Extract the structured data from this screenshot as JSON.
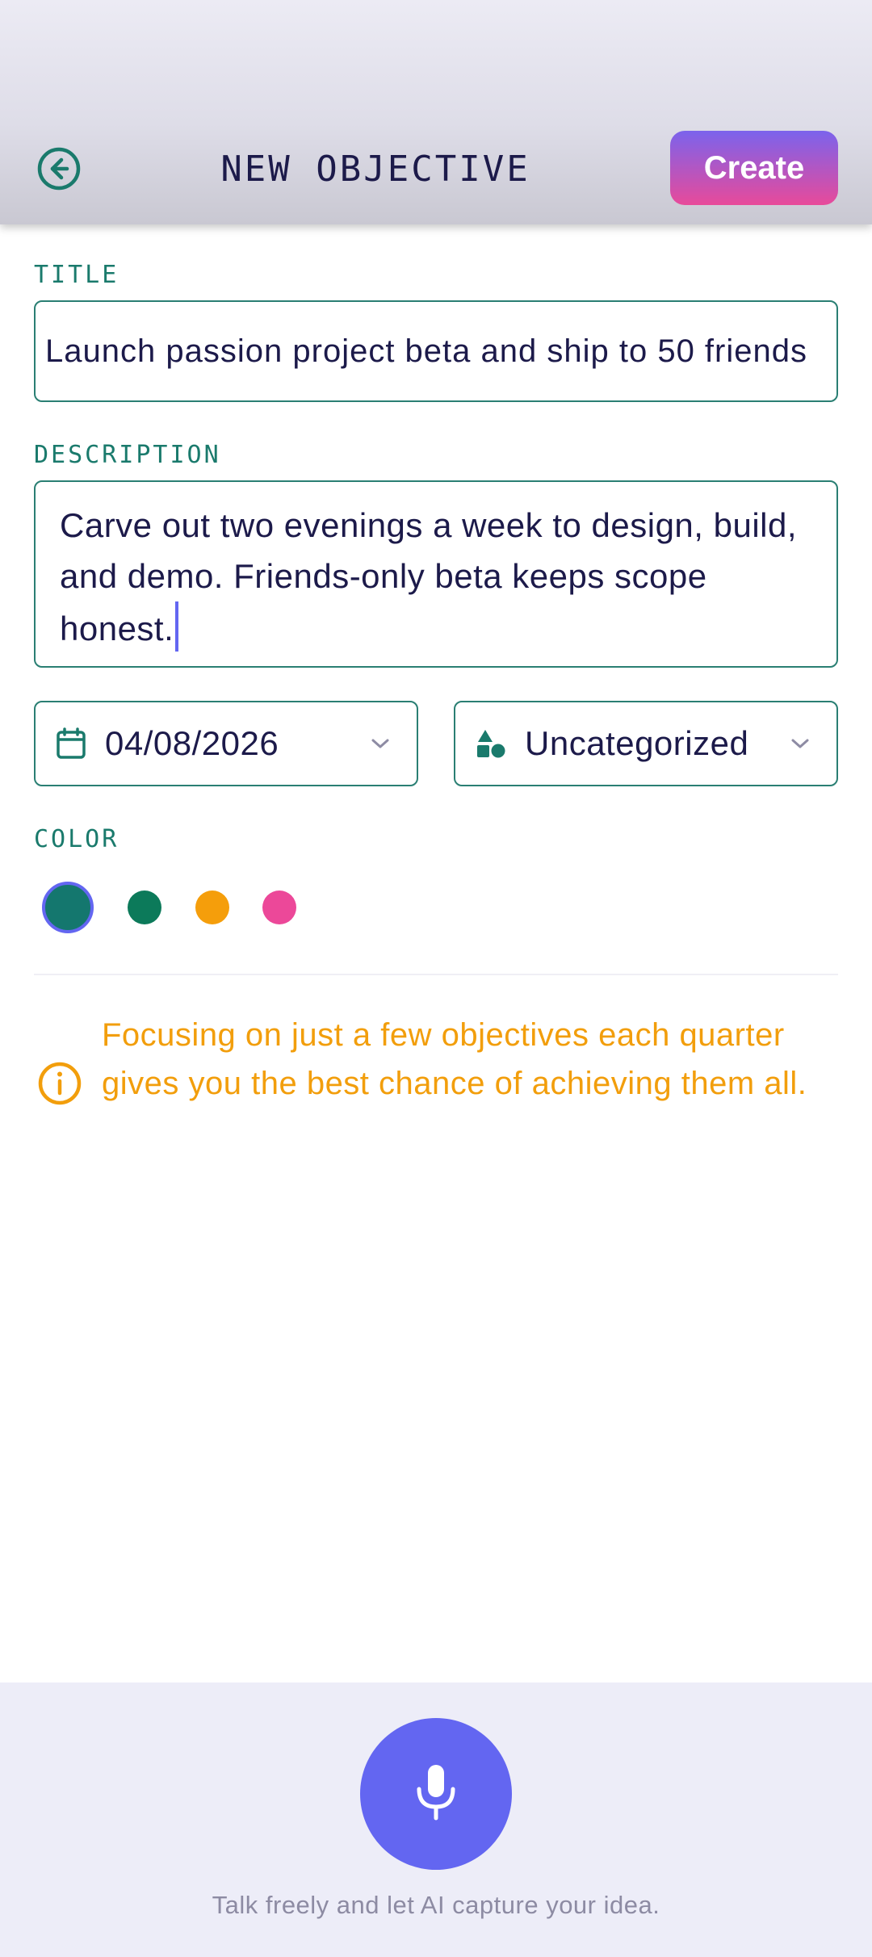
{
  "header": {
    "title": "NEW OBJECTIVE",
    "create_label": "Create"
  },
  "form": {
    "title_label": "TITLE",
    "title_value": "Launch passion project beta and ship to 50 friends",
    "description_label": "DESCRIPTION",
    "description_value": "Carve out two evenings a week to design, build, and demo. Friends-only beta keeps scope honest.",
    "date_value": "04/08/2026",
    "category_value": "Uncategorized",
    "color_label": "COLOR",
    "colors": [
      {
        "name": "teal",
        "hex": "#14776e",
        "selected": true
      },
      {
        "name": "green",
        "hex": "#0c7a5a",
        "selected": false
      },
      {
        "name": "amber",
        "hex": "#f59e0b",
        "selected": false
      },
      {
        "name": "pink",
        "hex": "#ec4899",
        "selected": false
      }
    ]
  },
  "tip": {
    "text": "Focusing on just a few objectives each quarter gives you the best chance of achieving them all."
  },
  "voice": {
    "hint": "Talk freely and let AI capture your idea."
  },
  "theme": {
    "accent": "#6366f1",
    "teal": "#1a7a6c",
    "warning": "#f29e0c",
    "create_gradient": [
      "#7b63ec",
      "#e84a9a"
    ]
  },
  "icons": {
    "back": "arrow-left-circle-icon",
    "calendar": "calendar-icon",
    "category": "shapes-icon",
    "chevron": "chevron-down-icon",
    "info": "info-circle-icon",
    "mic": "microphone-icon"
  }
}
